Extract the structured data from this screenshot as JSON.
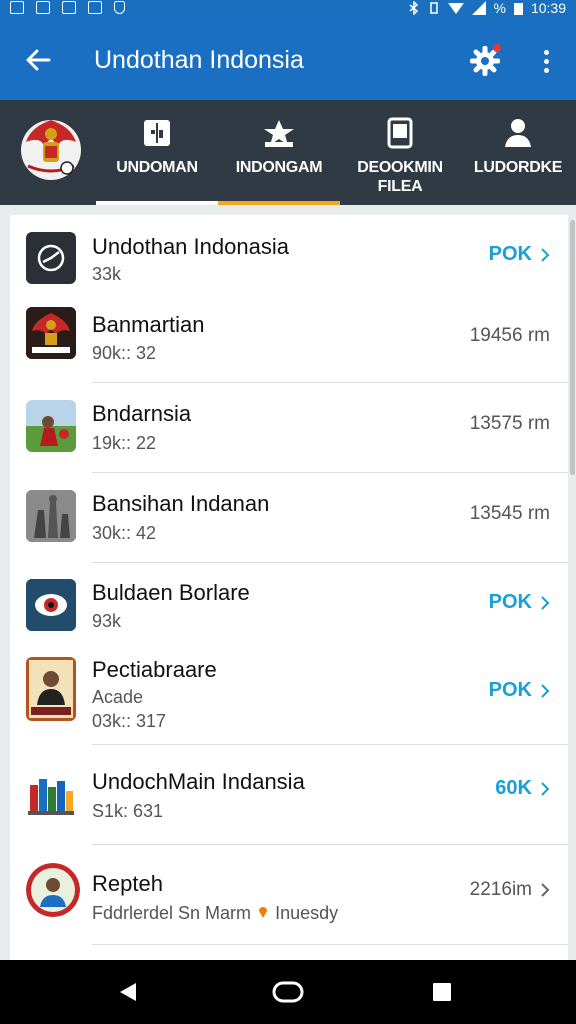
{
  "status": {
    "battery_text": "%",
    "time": "10:39"
  },
  "app_bar": {
    "title": "Undothan Indonsia"
  },
  "tabs": [
    {
      "label": "UNDOMAN",
      "icon": "book-icon",
      "indicator": "#ffffff"
    },
    {
      "label": "INDONGAM",
      "icon": "star-icon",
      "indicator": "#f5a623"
    },
    {
      "label": "DEOOKMIN\nFILEA",
      "icon": "document-icon",
      "indicator": ""
    },
    {
      "label": "LUDORDKE",
      "icon": "person-icon",
      "indicator": ""
    }
  ],
  "colors": {
    "accent": "#1a9fd6",
    "app_bar": "#1b6fc2",
    "tab_bar": "#2f3a44"
  },
  "items": [
    {
      "title": "Undothan Indonasia",
      "subtitle": "33k",
      "subtitle2": "",
      "action": "POK",
      "meta": "",
      "thumb": "app-logo-icon"
    },
    {
      "title": "Banmartian",
      "subtitle": "90k:: 32",
      "subtitle2": "",
      "action": "",
      "meta": "19456 rm",
      "thumb": "garuda-thumbnail"
    },
    {
      "title": "Bndarnsia",
      "subtitle": "19k:: 22",
      "subtitle2": "",
      "action": "",
      "meta": "13575 rm",
      "thumb": "photo-thumbnail"
    },
    {
      "title": "Bansihan Indanan",
      "subtitle": "30k:: 42",
      "subtitle2": "",
      "action": "",
      "meta": "13545 rm",
      "thumb": "statues-thumbnail"
    },
    {
      "title": "Buldaen Borlare",
      "subtitle": "93k",
      "subtitle2": "",
      "action": "POK",
      "meta": "",
      "thumb": "eye-logo-icon"
    },
    {
      "title": "Pectiabraare",
      "subtitle": "Acade",
      "subtitle2": "03k:: 317",
      "action": "POK",
      "meta": "",
      "thumb": "portrait-thumbnail"
    },
    {
      "title": "UndochMain Indansia",
      "subtitle": "S1k: 631",
      "subtitle2": "",
      "action": "60K",
      "meta": "",
      "thumb": "books-thumbnail"
    },
    {
      "title": "Repteh",
      "subtitle": "Fddrlerdel Sn Marm",
      "subtitle2": "Inuesdy",
      "action": "",
      "meta": "2216im",
      "thumb": "avatar-thumbnail"
    }
  ]
}
